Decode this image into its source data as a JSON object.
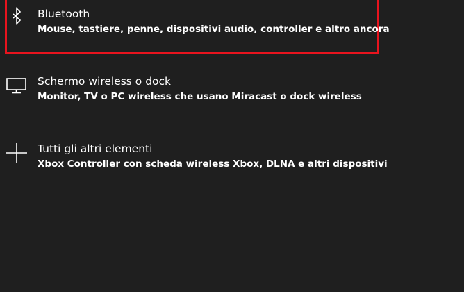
{
  "options": [
    {
      "title": "Bluetooth",
      "description": "Mouse, tastiere, penne, dispositivi audio, controller e altro ancora",
      "icon": "bluetooth-icon"
    },
    {
      "title": "Schermo wireless o dock",
      "description": "Monitor, TV o PC wireless che usano Miracast o dock wireless",
      "icon": "monitor-icon"
    },
    {
      "title": "Tutti gli altri elementi",
      "description": "Xbox Controller con scheda wireless Xbox, DLNA e altri dispositivi",
      "icon": "plus-icon"
    }
  ],
  "colors": {
    "background": "#1f1f1f",
    "text": "#ffffff",
    "highlight": "#e8141e"
  }
}
